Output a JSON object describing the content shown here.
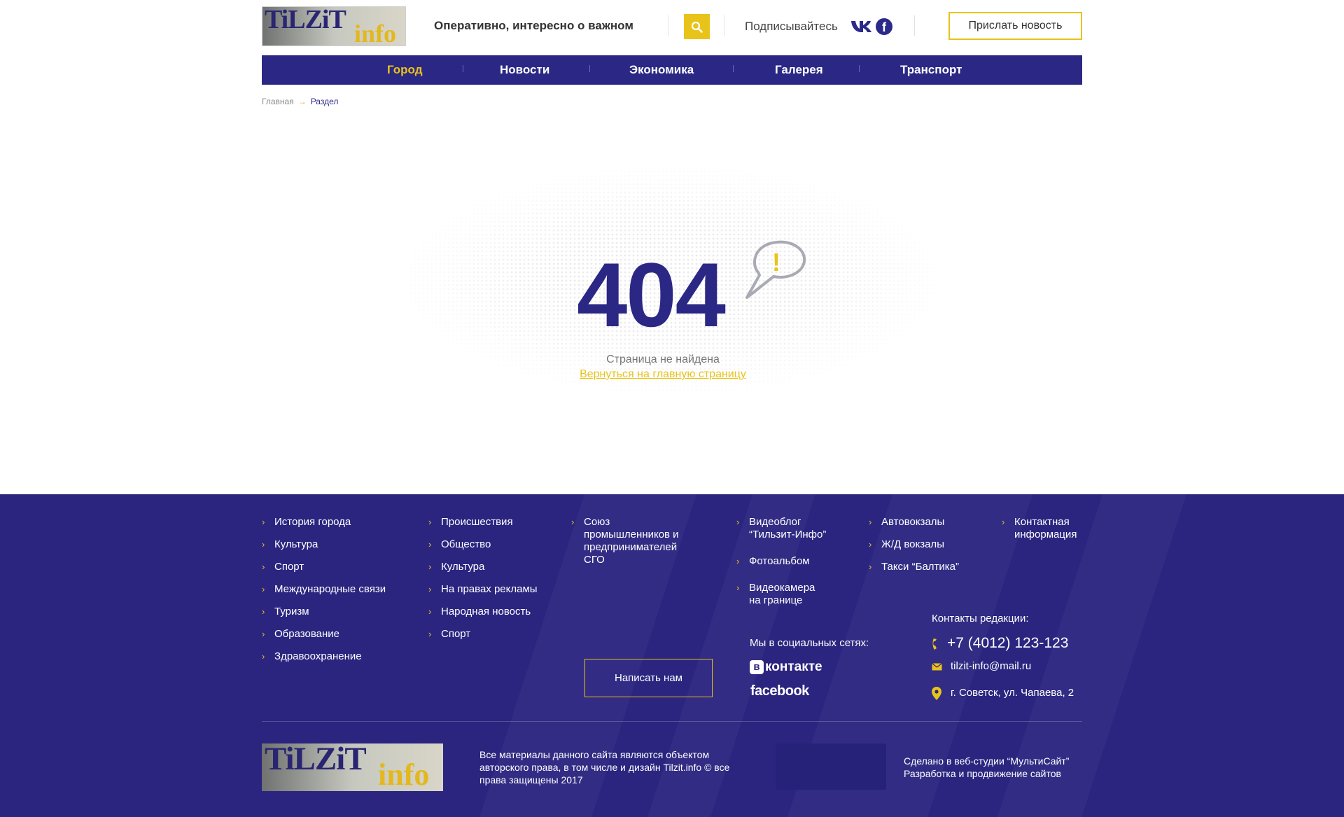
{
  "header": {
    "logo_text_1": "TiLZiT",
    "logo_text_2": "info",
    "tagline": "Оперативно, интересно о важном",
    "subscribe": "Подписывайтесь",
    "send_news": "Прислать новость"
  },
  "nav": {
    "items": [
      {
        "label": "Город",
        "active": true
      },
      {
        "label": "Новости",
        "active": false
      },
      {
        "label": "Экономика",
        "active": false
      },
      {
        "label": "Галерея",
        "active": false
      },
      {
        "label": "Транспорт",
        "active": false
      }
    ]
  },
  "breadcrumb": {
    "home": "Главная",
    "arrow": "→",
    "current": "Раздел"
  },
  "error": {
    "code": "404",
    "exclamation": "!",
    "message": "Страница не найдена",
    "link": "Вернуться на главную страницу"
  },
  "footer": {
    "col1": [
      "История города",
      "Культура",
      "Спорт",
      "Международные связи",
      "Туризм",
      "Образование",
      "Здравоохранение"
    ],
    "col2": [
      "Происшествия",
      "Общество",
      "Культура",
      "На правах рекламы",
      "Народная новость",
      "Спорт"
    ],
    "col3": [
      "Союз промышленников и предпринимателей СГО"
    ],
    "col4": [
      "Видеоблог “Тильзит-Инфо”",
      "Фотоальбом",
      "Видеокамера на границе"
    ],
    "col5": [
      "Автовокзалы",
      "Ж/Д вокзалы",
      "Такси “Балтика”"
    ],
    "col6": [
      "Контактная информация"
    ],
    "write_us": "Написать нам",
    "social_title": "Мы в социальных сетях:",
    "vk_badge": "в",
    "vk_word": "контакте",
    "fb_word": "facebook",
    "contacts_title": "Контакты редакции:",
    "phone": "+7 (4012) 123-123",
    "email": "tilzit-info@mail.ru",
    "address": "г. Советск, ул. Чапаева, 2",
    "logo_text_1": "TiLZiT",
    "logo_text_2": "info",
    "copyright": "Все материалы данного сайта являются объектом авторского права, в том числе и дизайн Tilzit.info © все права защищены 2017",
    "studio_line1": "Сделано в веб-студии “МультиСайт”",
    "studio_line2": "Разработка и продвижение сайтов"
  },
  "colors": {
    "brand_blue": "#2b2885",
    "accent_yellow": "#e8c31a",
    "footer_bg": "#2b2580"
  },
  "icons": [
    "search-icon",
    "vk-icon",
    "facebook-icon",
    "phone-icon",
    "mail-icon",
    "location-pin-icon",
    "chevron-right-icon",
    "speech-bubble-icon"
  ]
}
